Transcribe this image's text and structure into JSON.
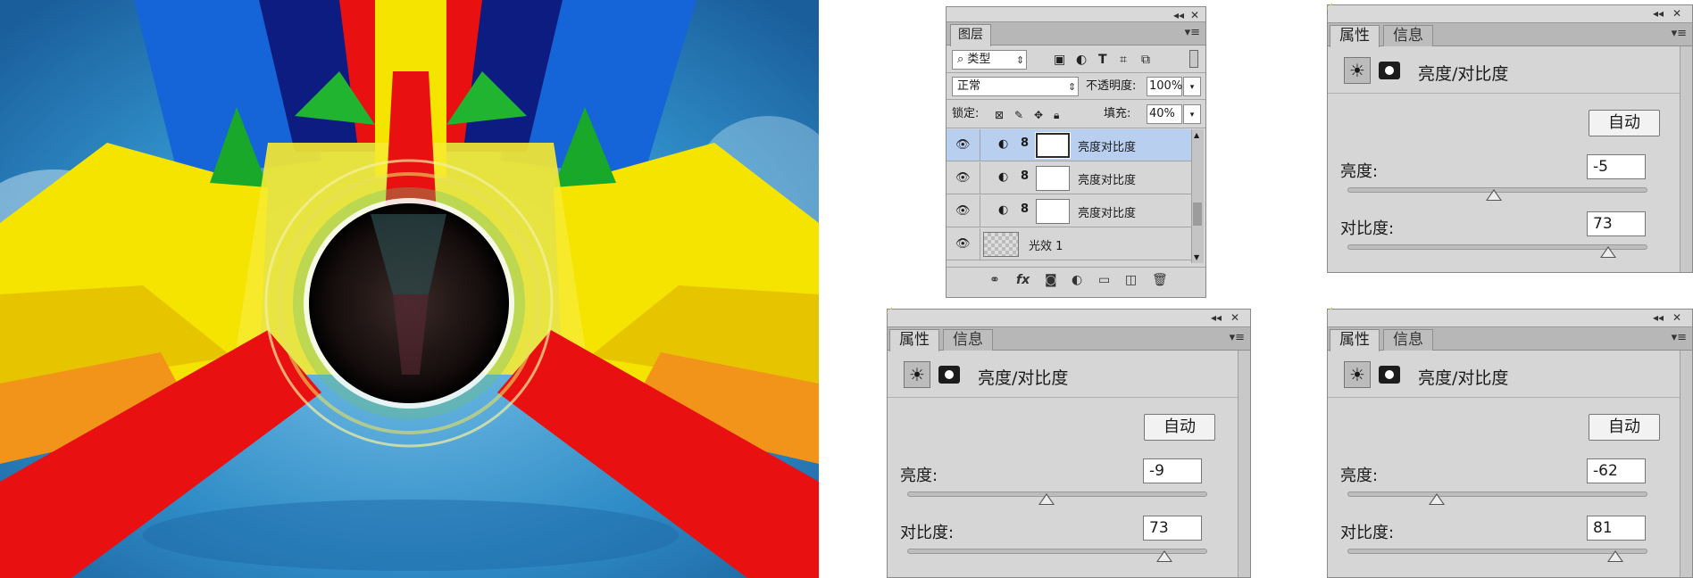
{
  "layers_panel": {
    "tab": "图层",
    "filter_label": "类型",
    "blend_mode": "正常",
    "opacity_label": "不透明度:",
    "opacity_value": "100%",
    "lock_label": "锁定:",
    "fill_label": "填充:",
    "fill_value": "40%",
    "layers": [
      {
        "name": "亮度对比度",
        "selected": true
      },
      {
        "name": "亮度对比度",
        "selected": false
      },
      {
        "name": "亮度对比度",
        "selected": false
      },
      {
        "name": "光效 1",
        "selected": false
      }
    ]
  },
  "properties_panels": [
    {
      "tab_properties": "属性",
      "tab_info": "信息",
      "title": "亮度/对比度",
      "auto_label": "自动",
      "brightness_label": "亮度:",
      "brightness_value": "-5",
      "contrast_label": "对比度:",
      "contrast_value": "73"
    },
    {
      "tab_properties": "属性",
      "tab_info": "信息",
      "title": "亮度/对比度",
      "auto_label": "自动",
      "brightness_label": "亮度:",
      "brightness_value": "-9",
      "contrast_label": "对比度:",
      "contrast_value": "73"
    },
    {
      "tab_properties": "属性",
      "tab_info": "信息",
      "title": "亮度/对比度",
      "auto_label": "自动",
      "brightness_label": "亮度:",
      "brightness_value": "-62",
      "contrast_label": "对比度:",
      "contrast_value": "81"
    }
  ],
  "colors": {
    "panel_bg": "#d6d6d6",
    "tab_row": "#b7b7b7",
    "selected_layer": "#b9cff0",
    "art_yellow": "#f4e400",
    "art_red": "#e81010",
    "art_blue": "#1a5ad8",
    "art_green": "#1aa82a",
    "art_sky": "#3a9ad0"
  },
  "icons": [
    "eye-icon",
    "adjustment-layer-icon",
    "chain-link-icon",
    "panel-menu-icon",
    "collapse-icon",
    "close-icon",
    "brightness-sun-icon",
    "layer-mask-icon"
  ]
}
